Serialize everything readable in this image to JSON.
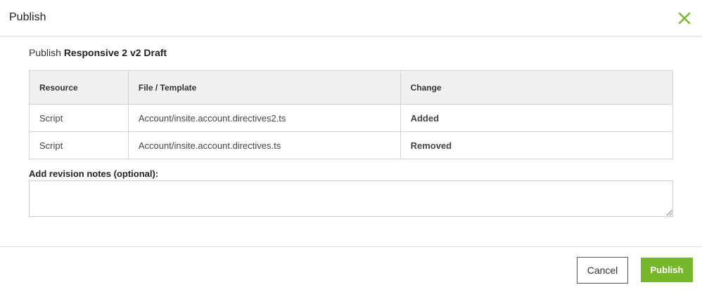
{
  "dialog": {
    "title": "Publish",
    "close_icon": "close-icon"
  },
  "publish_line": {
    "prefix": "Publish",
    "name": "Responsive 2 v2 Draft"
  },
  "table": {
    "headers": [
      "Resource",
      "File / Template",
      "Change"
    ],
    "rows": [
      {
        "resource": "Script",
        "file": "Account/insite.account.directives2.ts",
        "change": "Added"
      },
      {
        "resource": "Script",
        "file": "Account/insite.account.directives.ts",
        "change": "Removed"
      }
    ]
  },
  "notes": {
    "label": "Add revision notes (optional):",
    "value": "",
    "placeholder": ""
  },
  "footer": {
    "cancel_label": "Cancel",
    "publish_label": "Publish"
  },
  "colors": {
    "accent": "#76b82a",
    "added": "#76b82a",
    "removed": "#d81e4a"
  }
}
